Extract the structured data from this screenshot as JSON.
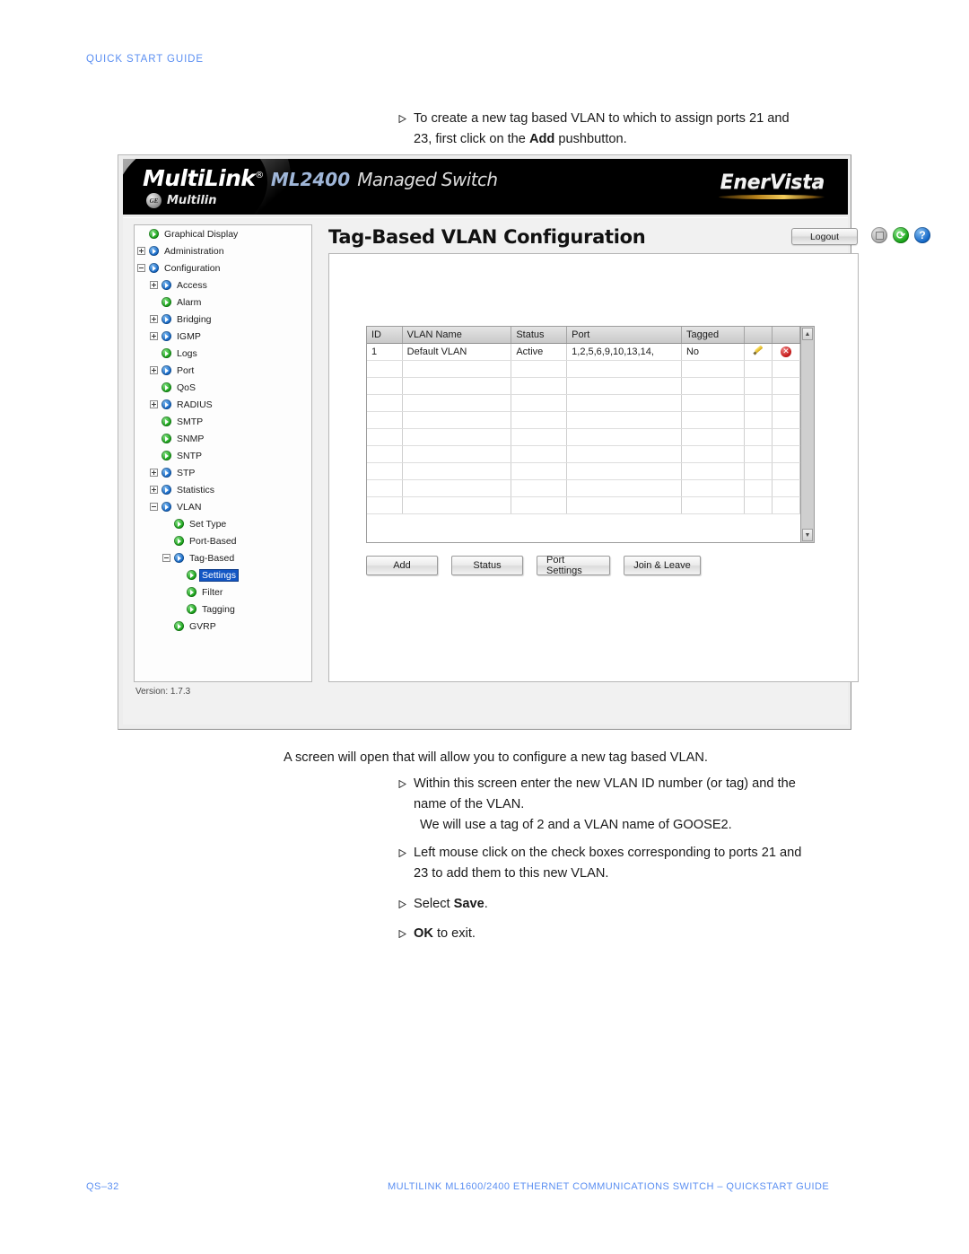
{
  "page": {
    "header_label": "QUICK START GUIDE",
    "footer_page": "QS–32",
    "footer_title": "MULTILINK ML1600/2400 ETHERNET COMMUNICATIONS SWITCH – QUICKSTART GUIDE"
  },
  "instructions": {
    "top": {
      "line1_a": "To create a new tag based VLAN to which to assign ports 21 and",
      "line2_a": "23, first click on the ",
      "line2_bold": "Add",
      "line2_b": " pushbutton."
    },
    "mid_intro": "A screen will open that will allow you to configure a new tag based VLAN.",
    "mid": {
      "line1": "Within this screen enter the new VLAN ID number (or tag) and the",
      "line2": "name of the VLAN.",
      "note": "We will use a tag of 2 and a VLAN name of GOOSE2."
    },
    "bottom": {
      "b1_line1": "Left mouse click on the check boxes corresponding to ports 21 and",
      "b1_line2": "23 to add them to this new VLAN.",
      "b2_pre": "Select ",
      "b2_bold": "Save",
      "b2_post": ".",
      "b3_bold": "OK",
      "b3_post": " to exit."
    }
  },
  "device": {
    "banner": {
      "brand": "MultiLink",
      "registered": "®",
      "model": "ML2400",
      "managed": "Managed Switch",
      "ge_badge": "GE",
      "sub_brand": "Multilin",
      "enervista": "EnerVista"
    },
    "tree": {
      "version_label": "Version: 1.7.3",
      "items": [
        {
          "label": "Graphical Display",
          "indent": 0,
          "toggle": "none",
          "icon": "green-node-icon"
        },
        {
          "label": "Administration",
          "indent": 0,
          "toggle": "plus",
          "icon": "blue-node-icon"
        },
        {
          "label": "Configuration",
          "indent": 0,
          "toggle": "minus",
          "icon": "blue-node-icon"
        },
        {
          "label": "Access",
          "indent": 1,
          "toggle": "plus",
          "icon": "blue-node-icon"
        },
        {
          "label": "Alarm",
          "indent": 1,
          "toggle": "none",
          "icon": "green-node-icon"
        },
        {
          "label": "Bridging",
          "indent": 1,
          "toggle": "plus",
          "icon": "blue-node-icon"
        },
        {
          "label": "IGMP",
          "indent": 1,
          "toggle": "plus",
          "icon": "blue-node-icon"
        },
        {
          "label": "Logs",
          "indent": 1,
          "toggle": "none",
          "icon": "green-node-icon"
        },
        {
          "label": "Port",
          "indent": 1,
          "toggle": "plus",
          "icon": "blue-node-icon"
        },
        {
          "label": "QoS",
          "indent": 1,
          "toggle": "none",
          "icon": "green-node-icon"
        },
        {
          "label": "RADIUS",
          "indent": 1,
          "toggle": "plus",
          "icon": "blue-node-icon"
        },
        {
          "label": "SMTP",
          "indent": 1,
          "toggle": "none",
          "icon": "green-node-icon"
        },
        {
          "label": "SNMP",
          "indent": 1,
          "toggle": "none",
          "icon": "green-node-icon"
        },
        {
          "label": "SNTP",
          "indent": 1,
          "toggle": "none",
          "icon": "green-node-icon"
        },
        {
          "label": "STP",
          "indent": 1,
          "toggle": "plus",
          "icon": "blue-node-icon"
        },
        {
          "label": "Statistics",
          "indent": 1,
          "toggle": "plus",
          "icon": "blue-node-icon"
        },
        {
          "label": "VLAN",
          "indent": 1,
          "toggle": "minus",
          "icon": "blue-node-icon"
        },
        {
          "label": "Set Type",
          "indent": 2,
          "toggle": "none",
          "icon": "green-node-icon"
        },
        {
          "label": "Port-Based",
          "indent": 2,
          "toggle": "none",
          "icon": "green-node-icon"
        },
        {
          "label": "Tag-Based",
          "indent": 2,
          "toggle": "minus",
          "icon": "blue-node-icon"
        },
        {
          "label": "Settings",
          "indent": 3,
          "toggle": "none",
          "icon": "green-node-icon",
          "selected": true
        },
        {
          "label": "Filter",
          "indent": 3,
          "toggle": "none",
          "icon": "green-node-icon"
        },
        {
          "label": "Tagging",
          "indent": 3,
          "toggle": "none",
          "icon": "green-node-icon"
        },
        {
          "label": "GVRP",
          "indent": 2,
          "toggle": "none",
          "icon": "green-node-icon"
        }
      ]
    },
    "main": {
      "title": "Tag-Based VLAN Configuration",
      "logout_label": "Logout",
      "toolbar_icons": [
        "save-disk-icon",
        "refresh-icon",
        "help-icon"
      ],
      "table": {
        "columns": [
          "ID",
          "VLAN Name",
          "Status",
          "Port",
          "Tagged",
          "",
          ""
        ],
        "rows": [
          {
            "id": "1",
            "vlan_name": "Default VLAN",
            "status": "Active",
            "port": "1,2,5,6,9,10,13,14,",
            "tagged": "No",
            "edit_icon": "pencil-edit-icon",
            "delete_icon": "delete-circle-icon"
          }
        ],
        "scrollbar": {
          "up": "▲",
          "down": "▼"
        }
      },
      "buttons": [
        {
          "label": "Add"
        },
        {
          "label": "Status"
        },
        {
          "label": "Port Settings"
        },
        {
          "label": "Join & Leave"
        }
      ]
    }
  },
  "colors": {
    "accent_blue": "#5b8ff2",
    "select_blue": "#1356c4",
    "node_green": "#18a318",
    "node_blue": "#1468c8",
    "delete_red": "#c61b1b"
  }
}
